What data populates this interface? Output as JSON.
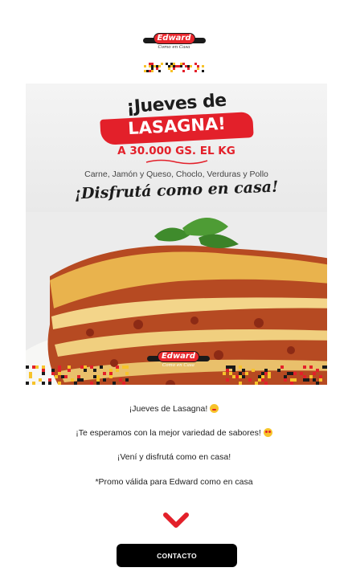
{
  "header": {
    "logo_brand": "Edward",
    "logo_tagline": "Como en Casa",
    "pixel_colors": [
      "#e3202a",
      "#f7c32a",
      "#1a1a1a"
    ]
  },
  "banner": {
    "headline_1": "¡Jueves de",
    "headline_2": "LASAGNA!",
    "price": "A 30.000 GS. EL KG",
    "fillings": "Carne, Jamón y Queso, Choclo, Verduras y Pollo",
    "slogan": "¡Disfrutá como en casa!",
    "logo_brand": "Edward",
    "logo_tagline": "Como en Casa",
    "accent": "#e3202a"
  },
  "body": {
    "line1": "¡Jueves de Lasagna!",
    "line2": "¡Te esperamos con la mejor variedad de sabores!",
    "line3": "¡Vení y disfrutá como en casa!",
    "line4": "*Promo válida para Edward como en casa"
  },
  "cta": {
    "label": "CONTACTO"
  },
  "icons": {
    "scroll": "chevron-down-icon"
  }
}
